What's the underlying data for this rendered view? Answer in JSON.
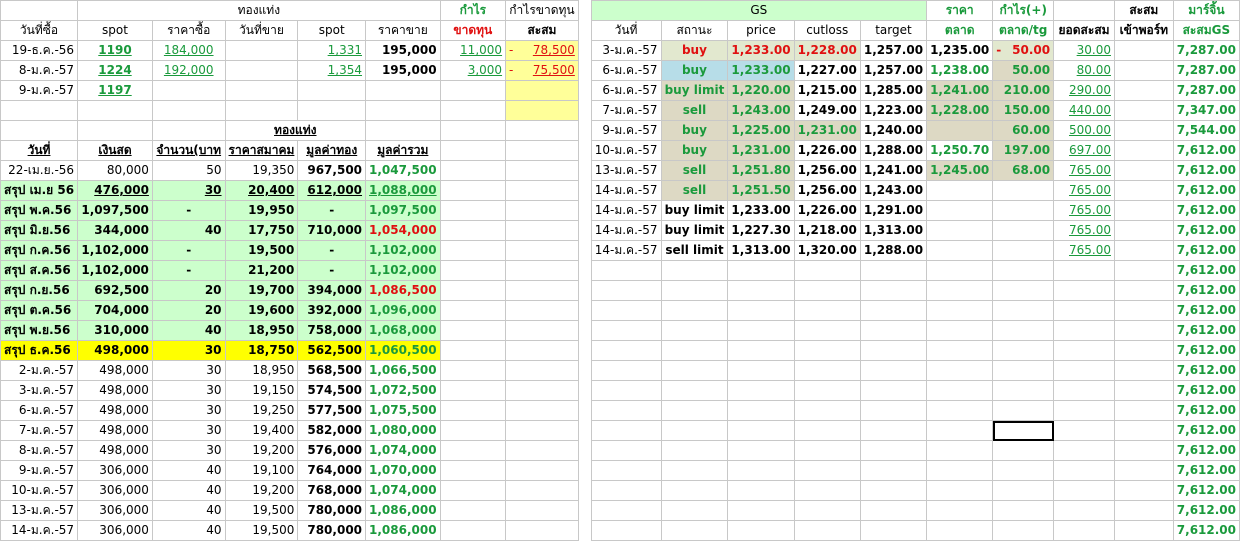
{
  "left_header": {
    "group_gold": "ทองแท่ง",
    "profit": "กำไร",
    "profit_cum": "กำไรขาดทุน",
    "cols": [
      "วันที่ซื้อ",
      "spot",
      "ราคาซื้อ",
      "วันที่ขาย",
      "spot",
      "ราคาขาย",
      "ขาดทุน",
      "สะสม"
    ]
  },
  "left_trades": [
    {
      "date": "19-ธ.ค.-56",
      "spot": "1190",
      "buy": "184,000",
      "sell_date": "",
      "spot2": "1,331",
      "sell": "195,000",
      "pl": "11,000",
      "cum_prefix": "-",
      "cum": "78,500"
    },
    {
      "date": "8-ม.ค.-57",
      "spot": "1224",
      "buy": "192,000",
      "sell_date": "",
      "spot2": "1,354",
      "sell": "195,000",
      "pl": "3,000",
      "cum_prefix": "-",
      "cum": "75,500"
    },
    {
      "date": "9-ม.ค.-57",
      "spot": "1197",
      "buy": "",
      "sell_date": "",
      "spot2": "",
      "sell": "",
      "pl": "",
      "cum_prefix": "",
      "cum": ""
    }
  ],
  "port_header": {
    "group_gold": "ทองแท่ง",
    "cols": [
      "วันที่",
      "เงินสด",
      "จำนวน(บาท",
      "ราคาสมาคม",
      "มูลค่าทอง",
      "มูลค่ารวม"
    ]
  },
  "port_rows": [
    {
      "d": "22-เม.ย.-56",
      "cash": "80,000",
      "qty": "50",
      "price": "19,350",
      "gold": "967,500",
      "total": "1,047,500"
    },
    {
      "d": "สรุป เม.ย 56",
      "cash": "476,000",
      "qty": "30",
      "price": "20,400",
      "gold": "612,000",
      "total": "1,088,000"
    },
    {
      "d": "สรุป พ.ค.56",
      "cash": "1,097,500",
      "qty": "-",
      "price": "19,950",
      "gold": "-",
      "total": "1,097,500"
    },
    {
      "d": "สรุป มิ.ย.56",
      "cash": "344,000",
      "qty": "40",
      "price": "17,750",
      "gold": "710,000",
      "total": "1,054,000"
    },
    {
      "d": "สรุป ก.ค.56",
      "cash": "1,102,000",
      "qty": "-",
      "price": "19,500",
      "gold": "-",
      "total": "1,102,000"
    },
    {
      "d": "สรุป ส.ค.56",
      "cash": "1,102,000",
      "qty": "-",
      "price": "21,200",
      "gold": "-",
      "total": "1,102,000"
    },
    {
      "d": "สรุป ก.ย.56",
      "cash": "692,500",
      "qty": "20",
      "price": "19,700",
      "gold": "394,000",
      "total": "1,086,500"
    },
    {
      "d": "สรุป ต.ค.56",
      "cash": "704,000",
      "qty": "20",
      "price": "19,600",
      "gold": "392,000",
      "total": "1,096,000"
    },
    {
      "d": "สรุป พ.ย.56",
      "cash": "310,000",
      "qty": "40",
      "price": "18,950",
      "gold": "758,000",
      "total": "1,068,000"
    },
    {
      "d": "สรุป ธ.ค.56",
      "cash": "498,000",
      "qty": "30",
      "price": "18,750",
      "gold": "562,500",
      "total": "1,060,500"
    },
    {
      "d": "2-ม.ค.-57",
      "cash": "498,000",
      "qty": "30",
      "price": "18,950",
      "gold": "568,500",
      "total": "1,066,500"
    },
    {
      "d": "3-ม.ค.-57",
      "cash": "498,000",
      "qty": "30",
      "price": "19,150",
      "gold": "574,500",
      "total": "1,072,500"
    },
    {
      "d": "6-ม.ค.-57",
      "cash": "498,000",
      "qty": "30",
      "price": "19,250",
      "gold": "577,500",
      "total": "1,075,500"
    },
    {
      "d": "7-ม.ค.-57",
      "cash": "498,000",
      "qty": "30",
      "price": "19,400",
      "gold": "582,000",
      "total": "1,080,000"
    },
    {
      "d": "8-ม.ค.-57",
      "cash": "498,000",
      "qty": "30",
      "price": "19,200",
      "gold": "576,000",
      "total": "1,074,000"
    },
    {
      "d": "9-ม.ค.-57",
      "cash": "306,000",
      "qty": "40",
      "price": "19,100",
      "gold": "764,000",
      "total": "1,070,000"
    },
    {
      "d": "10-ม.ค.-57",
      "cash": "306,000",
      "qty": "40",
      "price": "19,200",
      "gold": "768,000",
      "total": "1,074,000"
    },
    {
      "d": "13-ม.ค.-57",
      "cash": "306,000",
      "qty": "40",
      "price": "19,500",
      "gold": "780,000",
      "total": "1,086,000"
    },
    {
      "d": "14-ม.ค.-57",
      "cash": "306,000",
      "qty": "40",
      "price": "19,500",
      "gold": "780,000",
      "total": "1,086,000"
    }
  ],
  "gs_header": {
    "title": "GS",
    "price_group": "ราคา",
    "profit_group": "กำไร(+)",
    "cum_group": "สะสม",
    "margin_group": "มาร์จิ้น",
    "cols": [
      "วันที่",
      "สถานะ",
      "price",
      "cutloss",
      "target",
      "ตลาด",
      "ตลาด/tg",
      "ยอดสะสม",
      "เข้าพอร์ท",
      "สะสมGS"
    ]
  },
  "gs_rows": [
    {
      "d": "3-ม.ค.-57",
      "status": "buy",
      "price": "1,233.00",
      "cut": "1,228.00",
      "target": "1,257.00",
      "mkt": "1,235.00",
      "pf_prefix": "-",
      "pf": "50.00",
      "cum": "30.00",
      "port": "",
      "margin": "7,287.00"
    },
    {
      "d": "6-ม.ค.-57",
      "status": "buy",
      "price": "1,233.00",
      "cut": "1,227.00",
      "target": "1,257.00",
      "mkt": "1,238.00",
      "pf_prefix": "",
      "pf": "50.00",
      "cum": "80.00",
      "port": "",
      "margin": "7,287.00"
    },
    {
      "d": "6-ม.ค.-57",
      "status": "buy limit",
      "price": "1,220.00",
      "cut": "1,215.00",
      "target": "1,285.00",
      "mkt": "1,241.00",
      "pf_prefix": "",
      "pf": "210.00",
      "cum": "290.00",
      "port": "",
      "margin": "7,287.00"
    },
    {
      "d": "7-ม.ค.-57",
      "status": "sell",
      "price": "1,243.00",
      "cut": "1,249.00",
      "target": "1,223.00",
      "mkt": "1,228.00",
      "pf_prefix": "",
      "pf": "150.00",
      "cum": "440.00",
      "port": "",
      "margin": "7,347.00"
    },
    {
      "d": "9-ม.ค.-57",
      "status": "buy",
      "price": "1,225.00",
      "cut": "1,231.00",
      "target": "1,240.00",
      "mkt": "",
      "pf_prefix": "",
      "pf": "60.00",
      "cum": "500.00",
      "port": "",
      "margin": "7,544.00"
    },
    {
      "d": "10-ม.ค.-57",
      "status": "buy",
      "price": "1,231.00",
      "cut": "1,226.00",
      "target": "1,288.00",
      "mkt": "1,250.70",
      "pf_prefix": "",
      "pf": "197.00",
      "cum": "697.00",
      "port": "",
      "margin": "7,612.00"
    },
    {
      "d": "13-ม.ค.-57",
      "status": "sell",
      "price": "1,251.80",
      "cut": "1,256.00",
      "target": "1,241.00",
      "mkt": "1,245.00",
      "pf_prefix": "",
      "pf": "68.00",
      "cum": "765.00",
      "port": "",
      "margin": "7,612.00"
    },
    {
      "d": "14-ม.ค.-57",
      "status": "sell",
      "price": "1,251.50",
      "cut": "1,256.00",
      "target": "1,243.00",
      "mkt": "",
      "pf_prefix": "",
      "pf": "",
      "cum": "765.00",
      "port": "",
      "margin": "7,612.00"
    },
    {
      "d": "14-ม.ค.-57",
      "status": "buy limit",
      "price": "1,233.00",
      "cut": "1,226.00",
      "target": "1,291.00",
      "mkt": "",
      "pf_prefix": "",
      "pf": "",
      "cum": "765.00",
      "port": "",
      "margin": "7,612.00"
    },
    {
      "d": "14-ม.ค.-57",
      "status": "buy limit",
      "price": "1,227.30",
      "cut": "1,218.00",
      "target": "1,313.00",
      "mkt": "",
      "pf_prefix": "",
      "pf": "",
      "cum": "765.00",
      "port": "",
      "margin": "7,612.00"
    },
    {
      "d": "14-ม.ค.-57",
      "status": "sell limit",
      "price": "1,313.00",
      "cut": "1,320.00",
      "target": "1,288.00",
      "mkt": "",
      "pf_prefix": "",
      "pf": "",
      "cum": "765.00",
      "port": "",
      "margin": "7,612.00"
    }
  ],
  "gs_empty_margin": "7,612.00",
  "colors": {
    "green": "#1a9a3c",
    "red": "#e01010",
    "light_green": "#ccffcc",
    "yellow": "#ffff99",
    "highlight": "#ffff00",
    "tan": "#ddd9c4",
    "blue": "#b7dde8"
  }
}
